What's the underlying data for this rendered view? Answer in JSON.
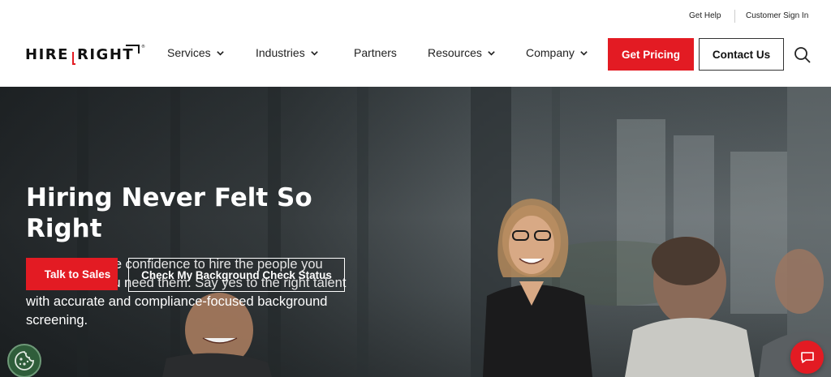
{
  "utility": {
    "help": "Get Help",
    "sign_in": "Customer Sign In"
  },
  "logo": {
    "part1": "HIRE",
    "part2": "RIGHT",
    "mark_color": "#e31b23"
  },
  "nav": {
    "items": [
      {
        "label": "Services",
        "has_dropdown": true
      },
      {
        "label": "Industries",
        "has_dropdown": true
      },
      {
        "label": "Partners",
        "has_dropdown": false
      },
      {
        "label": "Resources",
        "has_dropdown": true
      },
      {
        "label": "Company",
        "has_dropdown": true
      }
    ],
    "get_pricing": "Get Pricing",
    "contact_us": "Contact Us",
    "search_icon": "search-icon"
  },
  "hero": {
    "title": "Hiring Never Felt So Right",
    "subtitle": "We give you the confidence to hire the people you need, when you need them. Say yes to the right talent with accurate and compliance-focused background screening.",
    "cta_primary": "Talk to Sales",
    "cta_secondary": "Check My Background Check Status"
  },
  "widgets": {
    "cookie_icon": "cookie-icon",
    "chat_icon": "chat-icon"
  },
  "colors": {
    "brand_red": "#e31b23",
    "cookie_green": "#2f5d3a"
  }
}
